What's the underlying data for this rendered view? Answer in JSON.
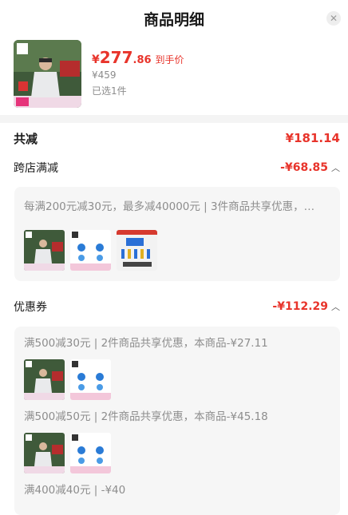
{
  "header": {
    "title": "商品明细",
    "close_icon": "close-icon"
  },
  "product": {
    "currency": "¥",
    "price_int": "277",
    "price_dec": ".86",
    "price_tag": "到手价",
    "original_price": "¥459",
    "selected_text": "已选1件"
  },
  "total": {
    "label": "共减",
    "amount": "¥181.14"
  },
  "cross_store": {
    "label": "跨店满减",
    "amount": "-¥68.85",
    "description": "每满200元减30元，最多减40000元 | 3件商品共享优惠，…"
  },
  "coupon": {
    "label": "优惠券",
    "amount": "-¥112.29",
    "items": [
      {
        "text": "满500减30元 | 2件商品共享优惠，本商品-¥27.11"
      },
      {
        "text": "满500减50元 | 2件商品共享优惠，本商品-¥45.18"
      },
      {
        "text": "满400减40元 | -¥40"
      }
    ]
  },
  "colors": {
    "accent": "#e8342b",
    "muted": "#8d8d8d",
    "card_bg": "#f6f6f6"
  }
}
